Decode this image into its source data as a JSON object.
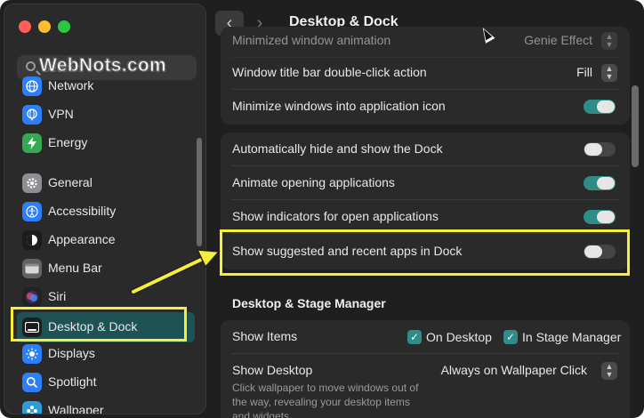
{
  "watermark": "WebNots.com",
  "search": {
    "placeholder": "Search"
  },
  "sidebar": {
    "items": [
      {
        "label": "Network",
        "icon": "globe-icon",
        "color": "#2d7ff9"
      },
      {
        "label": "VPN",
        "icon": "vpn-globe-icon",
        "color": "#2d7ff9"
      },
      {
        "label": "Energy",
        "icon": "bolt-icon",
        "color": "#34a853"
      },
      {
        "label": "General",
        "icon": "gear-icon",
        "color": "#8e8e93"
      },
      {
        "label": "Accessibility",
        "icon": "accessibility-icon",
        "color": "#2d7ff9"
      },
      {
        "label": "Appearance",
        "icon": "appearance-icon",
        "color": "#1c1c1e"
      },
      {
        "label": "Menu Bar",
        "icon": "menu-bar-icon",
        "color": "#636366"
      },
      {
        "label": "Siri",
        "icon": "siri-icon",
        "color": "#222"
      },
      {
        "label": "Desktop & Dock",
        "icon": "dock-icon",
        "color": "#1c1c1e",
        "selected": true
      },
      {
        "label": "Displays",
        "icon": "sun-icon",
        "color": "#2d7ff9"
      },
      {
        "label": "Spotlight",
        "icon": "magnifier-icon",
        "color": "#2d7ff9"
      },
      {
        "label": "Wallpaper",
        "icon": "wallpaper-icon",
        "color": "#2d9cdb"
      }
    ]
  },
  "header": {
    "title": "Desktop & Dock",
    "back_glyph": "‹",
    "forward_glyph": "›"
  },
  "settings": {
    "minimize_animation": {
      "label": "Minimized window animation",
      "value": "Genie Effect"
    },
    "double_click": {
      "label": "Window title bar double-click action",
      "value": "Fill"
    },
    "minimize_into_icon": {
      "label": "Minimize windows into application icon",
      "on": true
    },
    "auto_hide": {
      "label": "Automatically hide and show the Dock",
      "on": false
    },
    "animate_opening": {
      "label": "Animate opening applications",
      "on": true
    },
    "show_indicators": {
      "label": "Show indicators for open applications",
      "on": true
    },
    "show_suggested": {
      "label": "Show suggested and recent apps in Dock",
      "on": false
    }
  },
  "stage": {
    "title": "Desktop & Stage Manager",
    "show_items": {
      "label": "Show Items",
      "on_desktop": "On Desktop",
      "in_stage_manager": "In Stage Manager"
    },
    "show_desktop": {
      "label": "Show Desktop",
      "value": "Always on Wallpaper Click",
      "description_line1": "Click wallpaper to move windows out of",
      "description_line2": "the way, revealing your desktop items",
      "description_line3": "and widgets."
    }
  },
  "colors": {
    "accent": "#2f8c87",
    "highlight": "#f5ef3a",
    "selected_row": "#1e5254"
  }
}
